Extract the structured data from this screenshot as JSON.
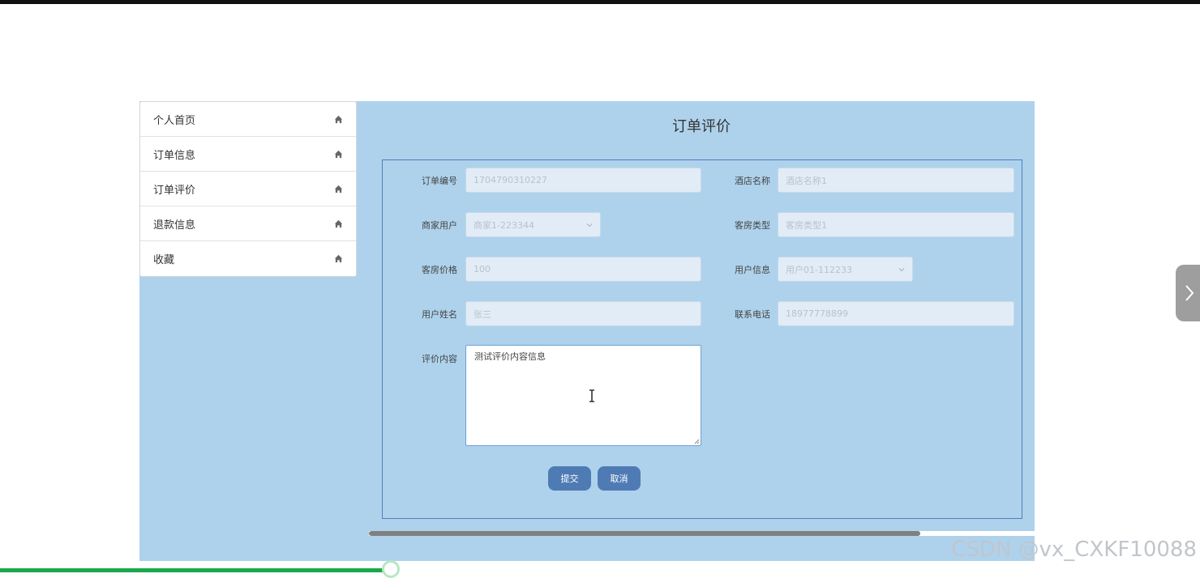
{
  "menu": {
    "items": [
      {
        "label": "个人首页"
      },
      {
        "label": "订单信息"
      },
      {
        "label": "订单评价"
      },
      {
        "label": "退款信息"
      },
      {
        "label": "收藏"
      }
    ]
  },
  "page": {
    "title": "订单评价"
  },
  "form": {
    "order_no_label": "订单编号",
    "order_no_value": "1704790310227",
    "hotel_name_label": "酒店名称",
    "hotel_name_value": "酒店名称1",
    "merchant_label": "商家用户",
    "merchant_value": "商家1-223344",
    "room_type_label": "客房类型",
    "room_type_value": "客房类型1",
    "room_price_label": "客房价格",
    "room_price_value": "100",
    "user_info_label": "用户信息",
    "user_info_value": "用户01-112233",
    "user_name_label": "用户姓名",
    "user_name_value": "张三",
    "phone_label": "联系电话",
    "phone_value": "18977778899",
    "review_label": "评价内容",
    "review_value": "测试评价内容信息",
    "submit_label": "提交",
    "cancel_label": "取消"
  },
  "watermark": "CSDN @vx_CXKF10088",
  "colors": {
    "panel_bg": "#aed2ec",
    "button": "#4f7bb5",
    "progress": "#19a94a"
  }
}
